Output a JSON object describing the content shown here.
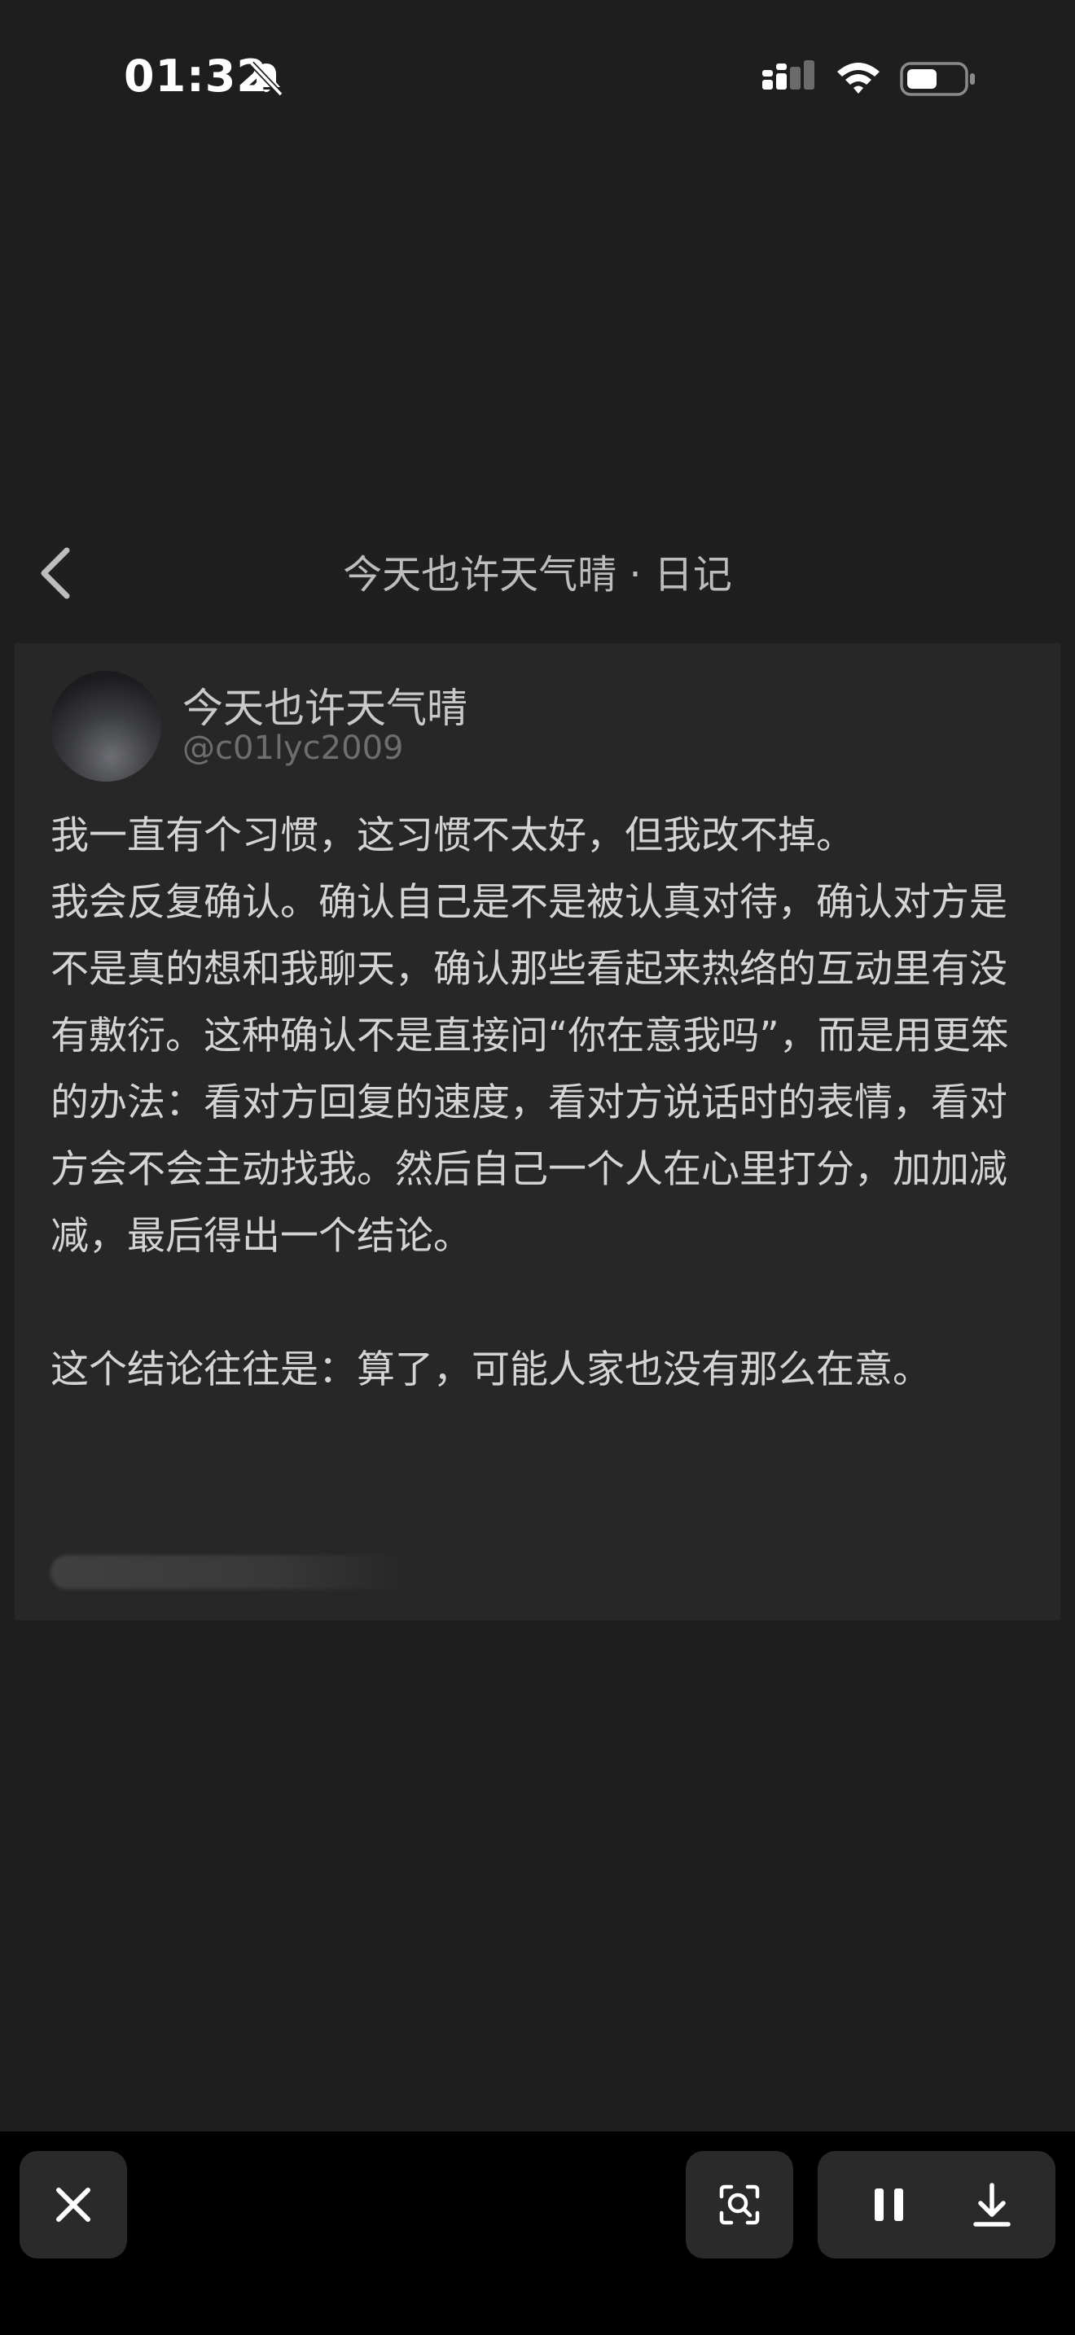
{
  "status_bar": {
    "time": "01:32",
    "icons": [
      "bell-slash-icon",
      "signal-icon",
      "wifi-icon",
      "battery-icon"
    ]
  },
  "header": {
    "back_icon": "chevron-left-icon",
    "title": "今天也许天气晴 · 日记"
  },
  "post": {
    "username": "今天也许天气晴",
    "handle": "@c01lyc2009",
    "paragraphs": [
      "我一直有个习惯，这习惯不太好，但我改不掉。",
      "我会反复确认。确认自己是不是被认真对待，确认对方是不是真的想和我聊天，确认那些看起来热络的互动里有没有敷衍。这种确认不是直接问“你在意我吗”，而是用更笨的办法：看对方回复的速度，看对方说话时的表情，看对方会不会主动找我。然后自己一个人在心里打分，加加减减，最后得出一个结论。",
      "这个结论往往是：算了，可能人家也没有那么在意。"
    ]
  },
  "toolbar": {
    "close_icon": "close-icon",
    "scan_icon": "scan-text-icon",
    "pause_icon": "pause-icon",
    "download_icon": "download-icon"
  },
  "colors": {
    "background": "#1e1e1e",
    "card": "#272727",
    "toolbar": "#000000",
    "button": "#2a2a2a"
  }
}
